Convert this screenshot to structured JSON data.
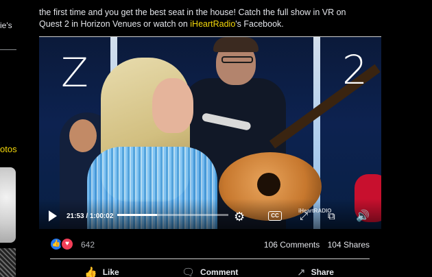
{
  "sidebar": {
    "fragment_text": "ie's",
    "link_text": "otos"
  },
  "post": {
    "line1": "the first time and you get the best seat in the house! Catch the full show in VR on",
    "line2_start": "Quest 2 in Horizon Venues or watch on ",
    "line2_link": "iHeartRadio",
    "line2_end": "'s Facebook."
  },
  "video": {
    "time_display": "21:53 / 1:00:02",
    "progress": 0.36,
    "watermark": "iHeartRADIO",
    "scribble_left": "Z",
    "scribble_right": "2",
    "cc_label": "CC"
  },
  "reactions": {
    "count": "642",
    "comments": "106 Comments",
    "shares": "104 Shares"
  },
  "actions": {
    "like": "Like",
    "comment": "Comment",
    "share": "Share"
  },
  "icons": {
    "play": "play-icon",
    "settings": "gear-icon",
    "captions": "closed-captions-icon",
    "fullscreen": "fullscreen-icon",
    "pip": "picture-in-picture-icon",
    "volume": "volume-icon",
    "like": "thumbs-up-icon",
    "love": "heart-icon",
    "comment": "comment-icon",
    "share": "share-icon"
  },
  "colors": {
    "link_yellow": "#f5d90a",
    "like_blue": "#2078f4",
    "love_red": "#f33e58"
  }
}
